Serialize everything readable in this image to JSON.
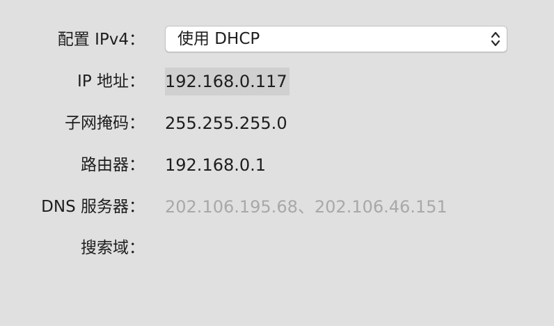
{
  "configure_ipv4": {
    "label": "配置 IPv4：",
    "selected_value": "使用 DHCP",
    "arrows_icon": "up-down-chevron-icon"
  },
  "ip_address": {
    "label": "IP 地址：",
    "value": "192.168.0.117"
  },
  "subnet_mask": {
    "label": "子网掩码：",
    "value": "255.255.255.0"
  },
  "router": {
    "label": "路由器：",
    "value": "192.168.0.1"
  },
  "dns_servers": {
    "label": "DNS 服务器：",
    "value": "202.106.195.68、202.106.46.151"
  },
  "search_domains": {
    "label": "搜索域：",
    "value": ""
  },
  "colors": {
    "background": "#e0e0e0",
    "text": "#1d1d1d",
    "muted_text": "#a8a8a8",
    "selection_highlight": "#d0d0d0"
  }
}
